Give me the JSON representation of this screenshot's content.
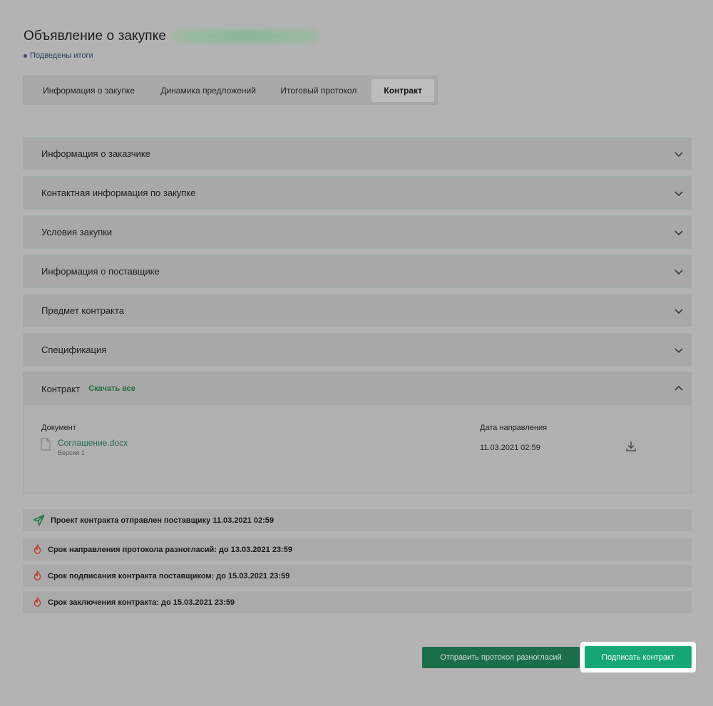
{
  "header": {
    "title": "Объявление о закупке",
    "status": "Подведены итоги"
  },
  "tabs": [
    {
      "label": "Информация о закупке"
    },
    {
      "label": "Динамика предложений"
    },
    {
      "label": "Итоговый протокол"
    },
    {
      "label": "Контракт",
      "active": true
    }
  ],
  "sections": [
    {
      "title": "Информация о заказчике"
    },
    {
      "title": "Контактная информация по закупке"
    },
    {
      "title": "Условия закупки"
    },
    {
      "title": "Информация о поставщике"
    },
    {
      "title": "Предмет контракта"
    },
    {
      "title": "Спецификация"
    }
  ],
  "contract": {
    "title": "Контракт",
    "download_all": "Скачать все",
    "doc_label": "Документ",
    "date_label": "Дата направления",
    "file_name": "Соглашение.docx",
    "file_version": "Версия 1",
    "send_date": "11.03.2021 02:59"
  },
  "info": [
    {
      "text": "Проект контракта отправлен поставщику 11.03.2021 02:59",
      "icon": "send-icon"
    },
    {
      "text": "Срок направления протокола разногласий: до 13.03.2021 23:59",
      "icon": "fire-icon"
    },
    {
      "text": "Срок подписания контракта поставщиком: до 15.03.2021 23:59",
      "icon": "fire-icon"
    },
    {
      "text": "Срок заключения контракта: до 15.03.2021 23:59",
      "icon": "fire-icon"
    }
  ],
  "buttons": {
    "send_protocol": "Отправить протокол разногласий",
    "sign_contract": "Подписать контракт"
  },
  "colors": {
    "accent": "#16a874",
    "secondary_button": "#1c6e4b",
    "link": "#1d6f47",
    "fire": "#c0392b"
  }
}
